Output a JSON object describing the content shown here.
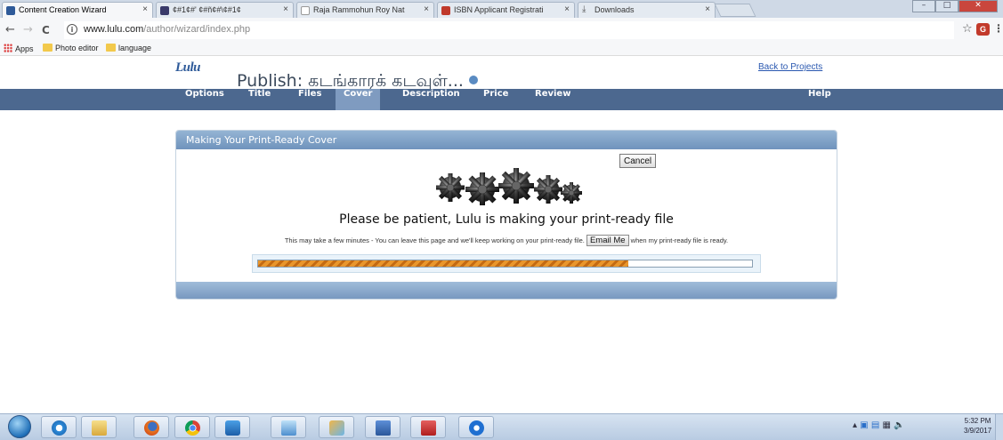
{
  "browser": {
    "tabs": [
      {
        "label": "Content Creation Wizard",
        "active": true,
        "favicon_color": "#2e5a99"
      },
      {
        "label": "¢#1¢#' ¢#ñ¢#\\¢#1¢",
        "active": false,
        "favicon_color": "#3a3a6a"
      },
      {
        "label": "Raja Rammohun Roy Nat",
        "active": false,
        "favicon_color": "#999999"
      },
      {
        "label": "ISBN Applicant Registrati",
        "active": false,
        "favicon_color": "#c0392b"
      },
      {
        "label": "Downloads",
        "active": false,
        "favicon_color": "#555555"
      }
    ],
    "tab_close": "×",
    "window_controls": [
      "–",
      "□",
      "✕"
    ],
    "back": "←",
    "forward": "→",
    "reload": "C",
    "url_host": "www.lulu.com",
    "url_path": "/author/wizard/index.php",
    "info_icon": "i",
    "bookmark_star": "☆",
    "extension_badge": "G",
    "menu": "⋮",
    "bookmarks": [
      {
        "label": "Apps",
        "icon": "apps-grid-icon"
      },
      {
        "label": "Photo editor",
        "icon": "folder-icon"
      },
      {
        "label": "language",
        "icon": "folder-icon"
      }
    ]
  },
  "page": {
    "logo": "Lulu",
    "title": "Publish: கடங்காரக் கடவுள்...",
    "back_link": "Back to Projects",
    "nav": [
      {
        "label": "Options",
        "active": false
      },
      {
        "label": "Title",
        "active": false
      },
      {
        "label": "Files",
        "active": false
      },
      {
        "label": "Cover",
        "active": true
      },
      {
        "label": "Description",
        "active": false
      },
      {
        "label": "Price",
        "active": false
      },
      {
        "label": "Review",
        "active": false
      }
    ],
    "help": "Help",
    "panel": {
      "heading": "Making Your Print-Ready Cover",
      "message": "Please be patient, Lulu is making your print-ready file",
      "detail_before": "This may take a few minutes - You can leave this page and we'll keep working on your print-ready file.",
      "email_button": "Email Me",
      "detail_after": "when my print-ready file is ready.",
      "progress_fraction": 0.75,
      "cancel": "Cancel"
    }
  },
  "taskbar": {
    "apps": [
      "start-orb",
      "internet-explorer",
      "file-explorer",
      "firefox",
      "chrome",
      "media-player",
      "network-monitor",
      "paint",
      "word",
      "acrobat",
      "teamviewer"
    ],
    "clock_time": "5:32 PM",
    "clock_date": "3/9/2017"
  }
}
